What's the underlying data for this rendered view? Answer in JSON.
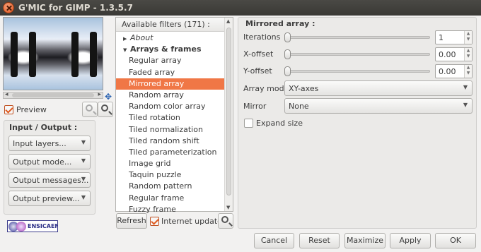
{
  "window": {
    "title": "G'MIC for GIMP - 1.3.5.7"
  },
  "preview": {
    "label": "Preview",
    "checked": true
  },
  "input_output": {
    "header": "Input / Output :",
    "combos": [
      "Input layers...",
      "Output mode...",
      "Output messages...",
      "Output preview..."
    ]
  },
  "logo": {
    "text": "ENSICAEN"
  },
  "filters": {
    "header": "Available filters (171) :",
    "items": [
      {
        "label": "About",
        "kind": "category-collapsed"
      },
      {
        "label": "Arrays & frames",
        "kind": "category-expanded"
      },
      {
        "label": "Regular array",
        "kind": "filter"
      },
      {
        "label": "Faded array",
        "kind": "filter"
      },
      {
        "label": "Mirrored array",
        "kind": "filter",
        "selected": true
      },
      {
        "label": "Random array",
        "kind": "filter"
      },
      {
        "label": "Random color array",
        "kind": "filter"
      },
      {
        "label": "Tiled rotation",
        "kind": "filter"
      },
      {
        "label": "Tiled normalization",
        "kind": "filter"
      },
      {
        "label": "Tiled random shift",
        "kind": "filter"
      },
      {
        "label": "Tiled parameterization",
        "kind": "filter"
      },
      {
        "label": "Image grid",
        "kind": "filter"
      },
      {
        "label": "Taquin puzzle",
        "kind": "filter"
      },
      {
        "label": "Random pattern",
        "kind": "filter"
      },
      {
        "label": "Regular frame",
        "kind": "filter"
      },
      {
        "label": "Fuzzy frame",
        "kind": "filter"
      }
    ],
    "refresh_label": "Refresh",
    "internet_updates_label": "Internet updates",
    "internet_updates_checked": true
  },
  "params": {
    "title": "Mirrored array :",
    "iterations": {
      "label": "Iterations",
      "value": "1"
    },
    "x_offset": {
      "label": "X-offset",
      "value": "0.00"
    },
    "y_offset": {
      "label": "Y-offset",
      "value": "0.00"
    },
    "array_mode": {
      "label": "Array mode",
      "value": "XY-axes"
    },
    "mirror": {
      "label": "Mirror",
      "value": "None"
    },
    "expand_size": {
      "label": "Expand size",
      "checked": false
    }
  },
  "buttons": {
    "cancel": "Cancel",
    "reset": "Reset",
    "maximize": "Maximize",
    "apply": "Apply",
    "ok": "OK"
  },
  "colors": {
    "selection": "#f07746",
    "titlebar": "#3c3b37",
    "window_bg": "#f2f1f0"
  }
}
